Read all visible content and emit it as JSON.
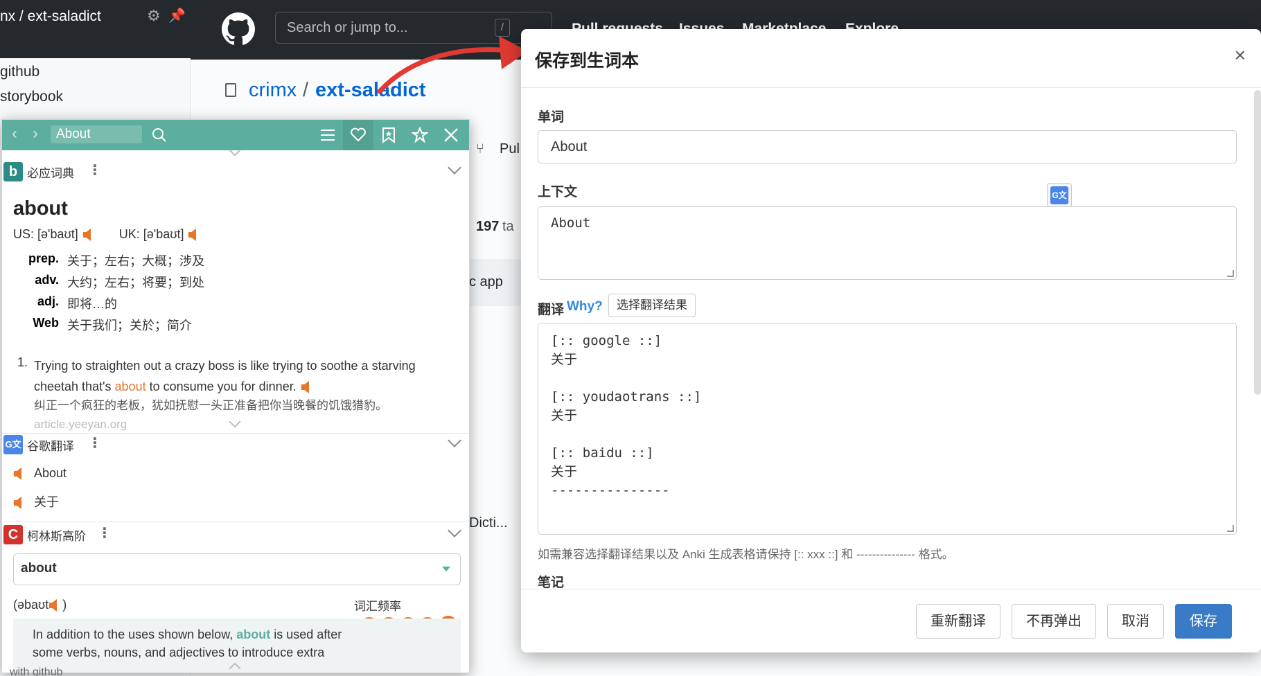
{
  "github": {
    "repo_tab": "nx / ext-saladict",
    "sidebar_items": [
      "github",
      "storybook"
    ],
    "search_placeholder": "Search or jump to...",
    "search_key": "/",
    "nav": [
      "Pull requests",
      "Issues",
      "Marketplace",
      "Explore"
    ],
    "owner": "crimx",
    "separator": "/",
    "repo": "ext-saladict",
    "pull_label": "Pul",
    "tags_count": "197",
    "tags_label": "ta",
    "row_app": "c app",
    "row_dict": "Dicti..."
  },
  "panel": {
    "search_value": "About",
    "bing": {
      "title": "必应词典",
      "word": "about",
      "us_phonetic": "US: [ə'baʊt]",
      "uk_phonetic": "UK: [ə'baʊt]",
      "defs": [
        {
          "pos": "prep.",
          "text": "关于；左右；大概；涉及"
        },
        {
          "pos": "adv.",
          "text": "大约；左右；将要；到处"
        },
        {
          "pos": "adj.",
          "text": "即将…的"
        },
        {
          "pos": "Web",
          "text": "关于我们；关於；简介"
        }
      ],
      "example_num": "1.",
      "example_before": "Trying to straighten out a crazy boss is like trying to soothe a starving cheetah that's ",
      "example_highlight": "about",
      "example_after": " to consume you for dinner.",
      "example_cn": "纠正一个疯狂的老板，犹如抚慰一头正准备把你当晚餐的饥饿猎豹。",
      "source": "article.yeeyan.org"
    },
    "google": {
      "title": "谷歌翻译",
      "src": "About",
      "trans": "关于"
    },
    "collins": {
      "title": "柯林斯高阶",
      "select_value": "about",
      "phonetic": "(əbaʊt",
      "phonetic_end": ")",
      "freq_label": "词汇频率",
      "freq_level": 5,
      "note_before": "In addition to the uses shown below, ",
      "note_highlight": "about",
      "note_after": " is used after some verbs, nouns, and adjectives to introduce extra",
      "footer_partial": "with github"
    }
  },
  "modal": {
    "title": "保存到生词本",
    "close": "×",
    "word_label": "单词",
    "word_value": "About",
    "context_label": "上下文",
    "context_value": "About",
    "trans_label": "翻译",
    "why_label": "Why?",
    "choose_label": "选择翻译结果",
    "trans_value": "[:: google ::]\n关于\n\n[:: youdaotrans ::]\n关于\n\n[:: baidu ::]\n关于\n---------------",
    "hint": "如需兼容选择翻译结果以及 Anki 生成表格请保持 [:: xxx ::] 和 --------------- 格式。",
    "notes_label": "笔记",
    "buttons": {
      "retranslate": "重新翻译",
      "no_popup": "不再弹出",
      "cancel": "取消",
      "save": "保存"
    }
  },
  "colors": {
    "panel_bar": "#5caf9e",
    "accent_orange": "#e8752a",
    "highlight_green": "#5caf9e",
    "save_button": "#3a7bc8"
  }
}
